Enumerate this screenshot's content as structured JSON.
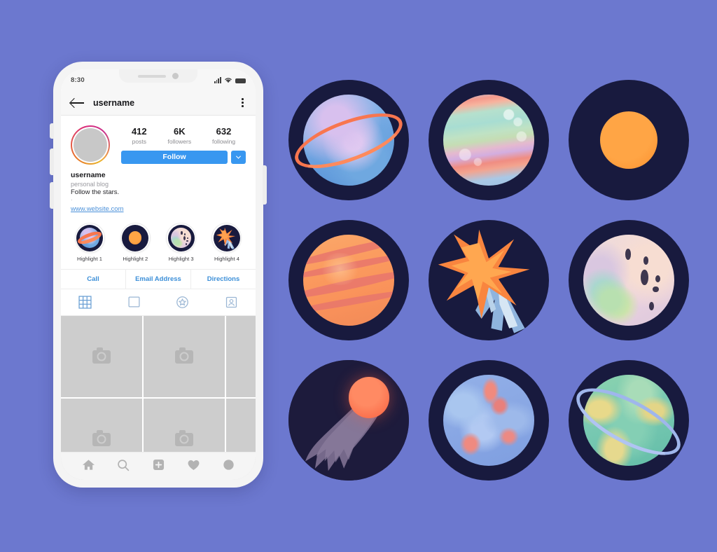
{
  "background_color": "#6c78cf",
  "phone": {
    "status_bar": {
      "time": "8:30",
      "signal_icon": "cellular-signal-icon",
      "wifi_icon": "wifi-icon",
      "battery_icon": "battery-icon"
    },
    "header": {
      "back_icon": "back-arrow-icon",
      "title": "username",
      "menu_icon": "kebab-menu-icon"
    },
    "profile": {
      "avatar_label": "profile-avatar",
      "stats": [
        {
          "value": "412",
          "label": "posts"
        },
        {
          "value": "6K",
          "label": "followers"
        },
        {
          "value": "632",
          "label": "following"
        }
      ],
      "follow_label": "Follow",
      "dropdown_icon": "chevron-down-icon",
      "accent_color": "#3897f0"
    },
    "bio": {
      "name": "username",
      "category": "personal blog",
      "text": "Follow the stars.",
      "separator": ".",
      "website": "www.website.com",
      "link_color": "#4a90d9"
    },
    "highlights": [
      {
        "label": "Highlight 1",
        "art": "ringed-planet"
      },
      {
        "label": "Highlight 2",
        "art": "sun"
      },
      {
        "label": "Highlight 3",
        "art": "moon"
      },
      {
        "label": "Highlight 4",
        "art": "shooting-star"
      }
    ],
    "actions": [
      "Call",
      "Email Address",
      "Directions"
    ],
    "tabs": [
      {
        "name": "grid-tab",
        "icon": "grid-icon",
        "active": true
      },
      {
        "name": "single-photo-tab",
        "icon": "square-icon",
        "active": false
      },
      {
        "name": "highlights-tab",
        "icon": "star-circle-icon",
        "active": false
      },
      {
        "name": "tagged-tab",
        "icon": "person-frame-icon",
        "active": false
      }
    ],
    "grid": {
      "placeholder_icon": "camera-icon",
      "cells": [
        "camera-icon",
        "camera-icon",
        "camera-icon",
        "camera-icon",
        "camera-icon",
        "camera-icon"
      ]
    },
    "bottom_nav": [
      {
        "name": "nav-home",
        "icon": "home-icon"
      },
      {
        "name": "nav-search",
        "icon": "search-icon"
      },
      {
        "name": "nav-add",
        "icon": "plus-square-icon"
      },
      {
        "name": "nav-activity",
        "icon": "heart-icon"
      },
      {
        "name": "nav-profile",
        "icon": "profile-circle-icon"
      }
    ]
  },
  "stickers": {
    "circle_bg": "#181a3e",
    "items": [
      {
        "id": "ringed-planet",
        "name": "Ringed planet sticker",
        "planet_color": "#7fb0e6",
        "ring_color": "#f8764f"
      },
      {
        "id": "pastel-planet",
        "name": "Pastel banded planet sticker",
        "planet_color": "#b6e0cd"
      },
      {
        "id": "sun",
        "name": "Sun sticker",
        "planet_color": "#fb9a3a",
        "ray_color": "#f2a24a",
        "ray_count": 36
      },
      {
        "id": "jupiter",
        "name": "Orange banded planet sticker",
        "planet_color": "#fb9a5e",
        "band_color": "#e8766c"
      },
      {
        "id": "shooting-star",
        "name": "Shooting star sticker",
        "planet_color": "#f9853f",
        "tail_color": "#8fb4de"
      },
      {
        "id": "moon",
        "name": "Moon sticker",
        "planet_color": "#f0d9dc",
        "crater_color": "#2a2540"
      },
      {
        "id": "comet",
        "name": "Comet sticker",
        "planet_color": "#f9603f",
        "tail_color": "#7a6d8e"
      },
      {
        "id": "blue-planet",
        "name": "Blue speckled planet sticker",
        "planet_color": "#8aa8e4"
      },
      {
        "id": "green-planet",
        "name": "Green ringed planet sticker",
        "planet_color": "#79c9b2",
        "ring_color": "#9fb6ec"
      }
    ]
  }
}
